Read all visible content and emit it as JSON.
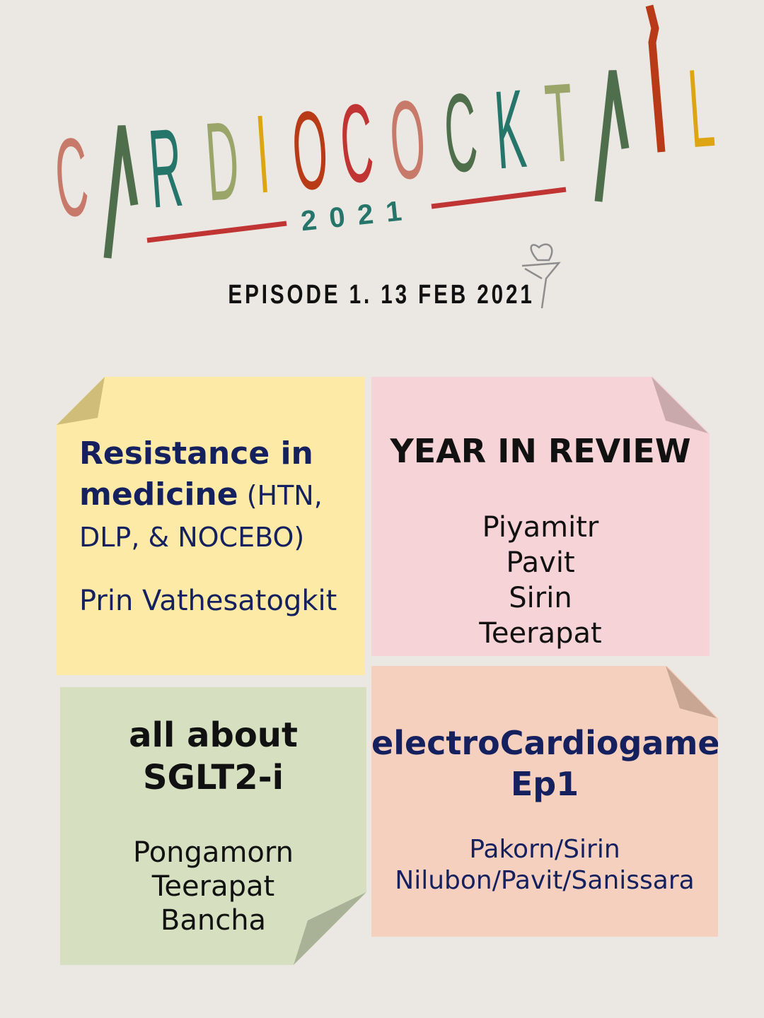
{
  "logo": {
    "title": "CARDIOCOCKTAIL",
    "year": "2021",
    "letter_colors": [
      "#c87a6a",
      "#4e6e4c",
      "#25756a",
      "#9aa56a",
      "#dea512",
      "#b83a16",
      "#c03433",
      "#c87a6a",
      "#4e6e4c",
      "#25756a",
      "#9aa56a",
      "#4e6e4c",
      "#b83a16",
      "#dea512"
    ],
    "line_color": "#c03433",
    "icon": "cocktail-glass-heart-icon"
  },
  "episode": "EPISODE 1. 13 FEB 2021",
  "notes": [
    {
      "color": "#fdeaa6",
      "title_bold": "Resistance in medicine",
      "title_rest": " (HTN, DLP, & NOCEBO)",
      "speakers": [
        "Prin Vathesatogkit"
      ]
    },
    {
      "color": "#f6d3d6",
      "title": "YEAR IN REVIEW",
      "speakers": [
        "Piyamitr",
        "Pavit",
        "Sirin",
        "Teerapat"
      ]
    },
    {
      "color": "#d6dfc0",
      "title_lines": [
        "all about",
        "SGLT2-i"
      ],
      "speakers": [
        "Pongamorn",
        "Teerapat",
        "Bancha"
      ]
    },
    {
      "color": "#f6d0be",
      "title_lines": [
        "electroCardiogame",
        "Ep1"
      ],
      "speakers": [
        "Pakorn/Sirin",
        "Nilubon/Pavit/Sanissara"
      ]
    }
  ]
}
